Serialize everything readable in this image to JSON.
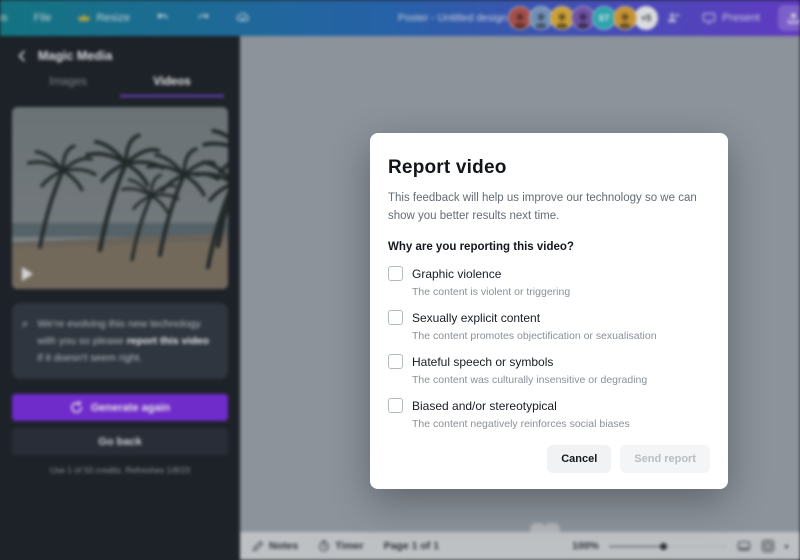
{
  "topbar": {
    "left_partial": "ns",
    "file_label": "File",
    "resize_label": "Resize",
    "doc_title": "Poster - Untitled design",
    "present_label": "Present",
    "avatars": [
      {
        "name": "avatar-1",
        "bg": "#b5564f"
      },
      {
        "name": "avatar-2",
        "bg": "#7e9fc9"
      },
      {
        "name": "avatar-3",
        "bg": "#e0b23a"
      },
      {
        "name": "avatar-4",
        "bg": "#7a5ab5"
      },
      {
        "name": "avatar-5",
        "bg": "#2fb5c0",
        "initials": "ST"
      },
      {
        "name": "avatar-6",
        "bg": "#d9a337"
      }
    ],
    "overflow_badge": "+5"
  },
  "sidebar": {
    "panel_title": "Magic Media",
    "tabs": [
      {
        "label": "Images"
      },
      {
        "label": "Videos"
      }
    ],
    "notice_text_1": "We're evolving this new technology with you so please ",
    "notice_link": "report this video",
    "notice_text_2": " if it doesn't seem right.",
    "generate_button": "Generate again",
    "go_back_button": "Go back",
    "credits_text": "Use 1 of 50 credits. Refreshes 1/8/23"
  },
  "canvas": {
    "add_page_button": "Add a new page",
    "pull_tab_glyph": "^"
  },
  "modal": {
    "title": "Report video",
    "description": "This feedback will help us improve our technology so we can show you better results next time.",
    "question": "Why are you reporting this video?",
    "options": [
      {
        "label": "Graphic violence",
        "description": "The content is violent or triggering",
        "checked": false
      },
      {
        "label": "Sexually explicit content",
        "description": "The content promotes objectification or sexualisation",
        "checked": false
      },
      {
        "label": "Hateful speech or symbols",
        "description": "The content was culturally insensitive or degrading",
        "checked": false
      },
      {
        "label": "Biased and/or stereotypical",
        "description": "The content negatively reinforces social biases",
        "checked": false
      }
    ],
    "cancel_button": "Cancel",
    "send_button": "Send report"
  },
  "bottombar": {
    "notes_label": "Notes",
    "timer_label": "Timer",
    "page_indicator": "Page 1 of 1",
    "zoom_level": "100%"
  },
  "colors": {
    "topbar_gradient_start": "#15808e",
    "topbar_gradient_mid": "#2a6cb8",
    "topbar_gradient_end": "#6b3fd6",
    "sidebar_bg": "#20252b",
    "accent_purple": "#7c2fe0",
    "tab_underline": "#7c4fe0",
    "canvas_bg": "#9ba3ab",
    "modal_bg": "#ffffff"
  }
}
